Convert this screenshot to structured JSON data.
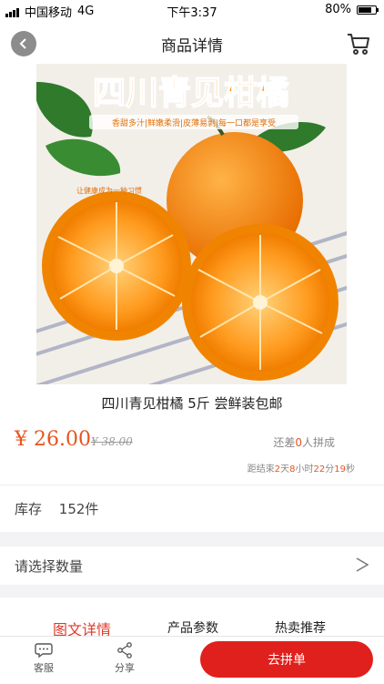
{
  "status_bar": {
    "carrier": "中国移动",
    "network": "4G",
    "time": "下午3:37",
    "battery": "80%",
    "battery_level": 0.8
  },
  "nav": {
    "title": "商品详情",
    "back_icon": "chevron-left-icon",
    "cart_icon": "cart-icon"
  },
  "product": {
    "image_title": "四川青见柑橘",
    "image_tagline": "香甜多汁|鲜嫩柔滑|皮薄易剥|每一口都是享受",
    "image_note": "让健康成为一种习惯",
    "name": "四川青见柑橘 5斤 尝鲜装包邮",
    "price": "¥ 26.00",
    "original_price": "¥ 38.00",
    "group_prefix": "还差",
    "group_count": "0",
    "group_suffix": "人拼成",
    "countdown": {
      "prefix": "距结束",
      "days": "2",
      "days_unit": "天",
      "hours": "8",
      "hours_unit": "小时",
      "minutes": "22",
      "minutes_unit": "分",
      "seconds": "19",
      "seconds_unit": "秒"
    }
  },
  "stock": {
    "label": "库存",
    "value": "152件"
  },
  "quantity": {
    "label": "请选择数量",
    "arrow": ">"
  },
  "tabs": [
    {
      "label": "图文详情",
      "active": true
    },
    {
      "label": "产品参数",
      "active": false
    },
    {
      "label": "热卖推荐",
      "active": false
    }
  ],
  "bottom_bar": {
    "service_label": "客服",
    "share_label": "分享",
    "join_label": "去拼单"
  },
  "colors": {
    "accent": "#e8541e",
    "button_red": "#e0201c",
    "tab_active": "#e03a2a"
  }
}
